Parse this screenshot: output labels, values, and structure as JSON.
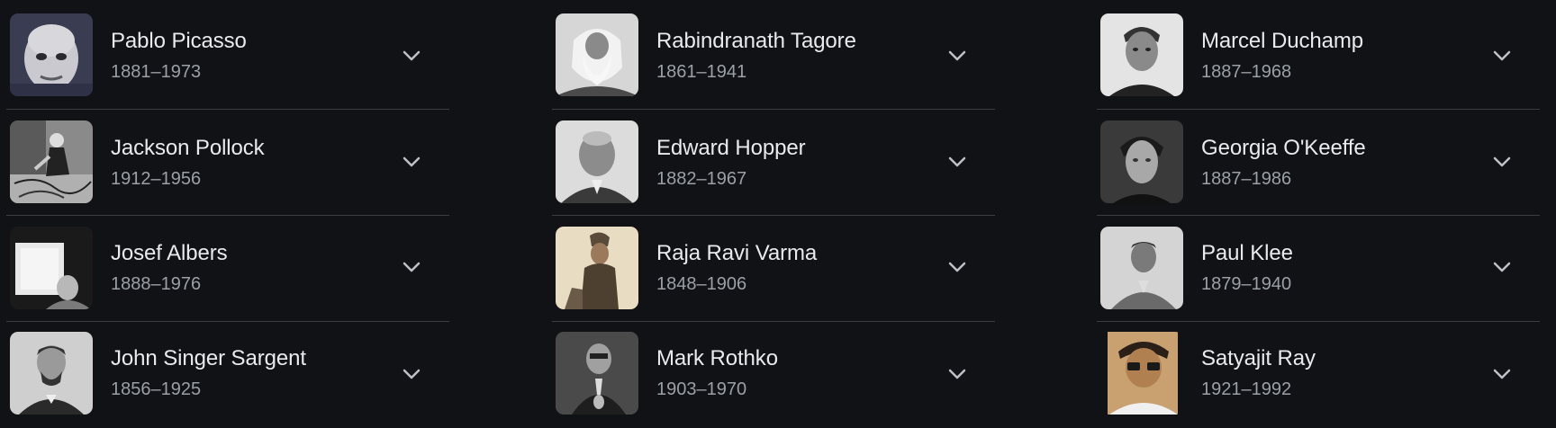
{
  "colors": {
    "background": "#111216",
    "name_text": "#e8eaed",
    "years_text": "#9aa0a6",
    "divider": "#3c3d42",
    "chevron": "#bdc1c6"
  },
  "columns": [
    {
      "items": [
        {
          "name": "Pablo Picasso",
          "years": "1881–1973",
          "icon": "chevron-down-icon"
        },
        {
          "name": "Jackson Pollock",
          "years": "1912–1956",
          "icon": "chevron-down-icon"
        },
        {
          "name": "Josef Albers",
          "years": "1888–1976",
          "icon": "chevron-down-icon"
        },
        {
          "name": "John Singer Sargent",
          "years": "1856–1925",
          "icon": "chevron-down-icon"
        }
      ]
    },
    {
      "items": [
        {
          "name": "Rabindranath Tagore",
          "years": "1861–1941",
          "icon": "chevron-down-icon"
        },
        {
          "name": "Edward Hopper",
          "years": "1882–1967",
          "icon": "chevron-down-icon"
        },
        {
          "name": "Raja Ravi Varma",
          "years": "1848–1906",
          "icon": "chevron-down-icon"
        },
        {
          "name": "Mark Rothko",
          "years": "1903–1970",
          "icon": "chevron-down-icon"
        }
      ]
    },
    {
      "items": [
        {
          "name": "Marcel Duchamp",
          "years": "1887–1968",
          "icon": "chevron-down-icon"
        },
        {
          "name": "Georgia O'Keeffe",
          "years": "1887–1986",
          "icon": "chevron-down-icon"
        },
        {
          "name": "Paul Klee",
          "years": "1879–1940",
          "icon": "chevron-down-icon"
        },
        {
          "name": "Satyajit Ray",
          "years": "1921–1992",
          "icon": "chevron-down-icon"
        }
      ]
    }
  ]
}
